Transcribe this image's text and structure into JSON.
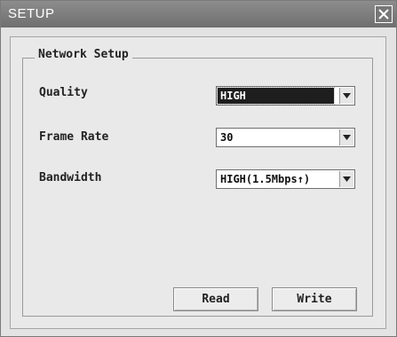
{
  "window": {
    "title": "SETUP",
    "close_icon": "close-icon"
  },
  "network_setup": {
    "legend": "Network Setup",
    "quality": {
      "label": "Quality",
      "value": "HIGH"
    },
    "frame_rate": {
      "label": "Frame Rate",
      "value": "30"
    },
    "bandwidth": {
      "label": "Bandwidth",
      "value": "HIGH(1.5Mbps↑)"
    }
  },
  "buttons": {
    "read": "Read",
    "write": "Write"
  },
  "colors": {
    "titlebar": "#7d7d7d",
    "selection": "#1e1e1e",
    "background": "#e9e9e9"
  }
}
